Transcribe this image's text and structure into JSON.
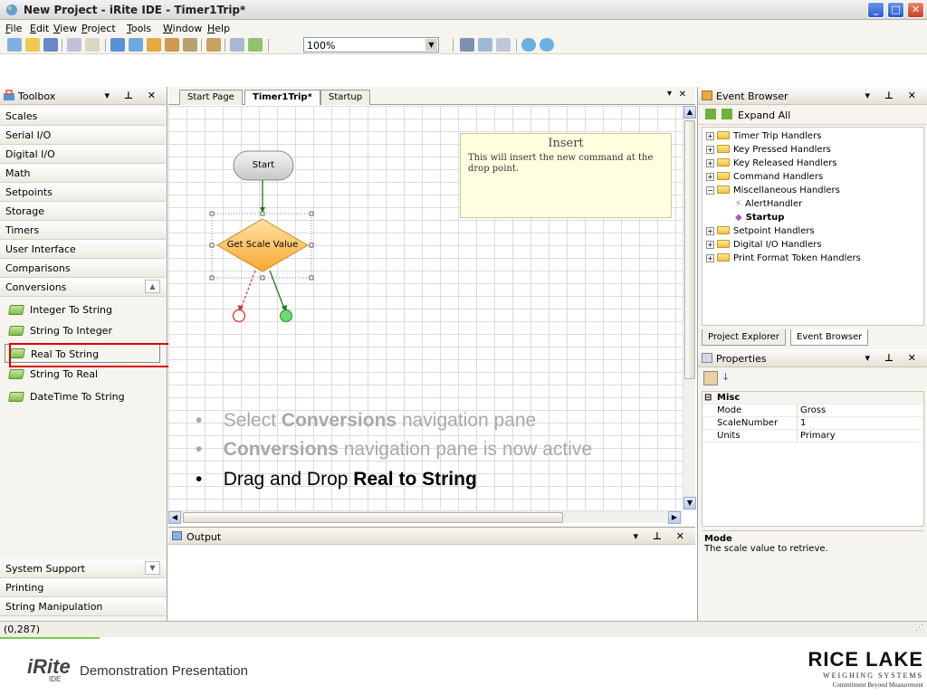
{
  "window": {
    "title": "New Project - iRite IDE - Timer1Trip*",
    "minimize": "_",
    "maximize": "□",
    "close": "✕"
  },
  "menu": [
    "File",
    "Edit",
    "View",
    "Project",
    "Tools",
    "Window",
    "Help"
  ],
  "toolbar": {
    "zoom": "100%"
  },
  "toolbox": {
    "title": "Toolbox",
    "categories_top": [
      "Scales",
      "Serial I/O",
      "Digital I/O",
      "Math",
      "Setpoints",
      "Storage",
      "Timers",
      "User Interface",
      "Comparisons",
      "Conversions"
    ],
    "tools": [
      "Integer To String",
      "String To Integer",
      "Real To String",
      "String To Real",
      "DateTime To String"
    ],
    "categories_bottom": [
      "System Support",
      "Printing",
      "String Manipulation"
    ],
    "highlighted_tool": "Real To String"
  },
  "document": {
    "tabs": [
      "Start Page",
      "Timer1Trip*",
      "Startup"
    ],
    "active_tab": "Timer1Trip*",
    "close": "✕"
  },
  "flowchart": {
    "start_label": "Start",
    "decision_label": "Get Scale Value"
  },
  "insert_tip": {
    "title": "Insert",
    "body": "This will insert the new command at the drop point."
  },
  "bullets": {
    "b1_pre": "Select ",
    "b1_bold": "Conversions",
    "b1_post": " navigation pane",
    "b2_bold": "Conversions",
    "b2_post": " navigation pane is now active",
    "b3_pre": "Drag and Drop ",
    "b3_bold": "Real to String",
    "marker": "•"
  },
  "output": {
    "title": "Output"
  },
  "event_browser": {
    "title": "Event Browser",
    "expand_all": "Expand All",
    "nodes": [
      "Timer Trip Handlers",
      "Key Pressed Handlers",
      "Key Released Handlers",
      "Command Handlers",
      "Miscellaneous Handlers",
      "AlertHandler",
      "Startup",
      "Setpoint Handlers",
      "Digital I/O Handlers",
      "Print Format Token Handlers"
    ],
    "tabs": [
      "Project Explorer",
      "Event Browser"
    ]
  },
  "properties": {
    "title": "Properties",
    "section": "Misc",
    "rows": [
      {
        "key": "Mode",
        "value": "Gross"
      },
      {
        "key": "ScaleNumber",
        "value": "1"
      },
      {
        "key": "Units",
        "value": "Primary"
      }
    ],
    "desc_title": "Mode",
    "desc_body": "The scale value to retrieve."
  },
  "status": {
    "text": "(0,287)"
  },
  "footer": {
    "logo": "iRite",
    "logo_sub": "IDE",
    "caption": "Demonstration Presentation",
    "company": "RICE LAKE",
    "company_sub": "WEIGHING SYSTEMS",
    "tagline": "Commitment Beyond Measurement"
  },
  "colors": {
    "highlight": "#e00000",
    "decision_fill": "#ffc35a",
    "end_ok": "#6ddc6d",
    "end_err": "#ff4040"
  }
}
